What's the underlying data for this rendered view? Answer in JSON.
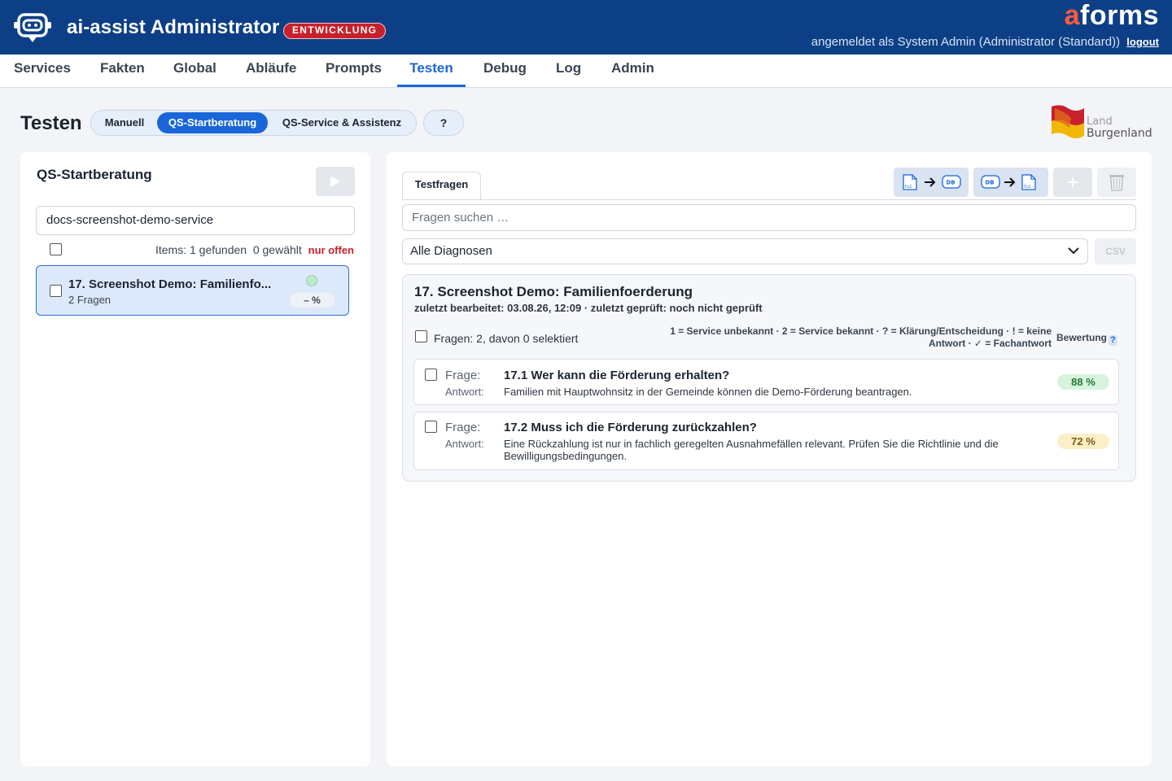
{
  "header": {
    "app_title": "ai-assist Administrator",
    "env_badge": "ENTWICKLUNG",
    "brand_first": "a",
    "brand_rest": "forms",
    "login_text": "angemeldet als System Admin (Administrator (Standard))",
    "logout_label": "logout"
  },
  "nav": {
    "items": [
      "Services",
      "Fakten",
      "Global",
      "Abläufe",
      "Prompts",
      "Testen",
      "Debug",
      "Log",
      "Admin"
    ],
    "active": "Testen"
  },
  "page": {
    "title": "Testen",
    "modes": [
      "Manuell",
      "QS-Startberatung",
      "QS-Service & Assistenz"
    ],
    "active_mode": "QS-Startberatung",
    "help_label": "?",
    "logo_line1": "Land",
    "logo_line2": "Burgenland"
  },
  "left": {
    "title": "QS-Startberatung",
    "service_value": "docs-screenshot-demo-service",
    "items_info": "Items: 1 gefunden  0 gewählt",
    "only_open_label": "nur offen",
    "list": [
      {
        "title": "17. Screenshot Demo: Familienfo...",
        "subtitle": "2 Fragen",
        "pct": "– %"
      }
    ]
  },
  "right": {
    "tab_label": "Testfragen",
    "toolbar_icons": [
      "file-to-db-icon",
      "db-to-file-icon",
      "plus-icon",
      "trash-icon"
    ],
    "search_placeholder": "Fragen suchen …",
    "diagnosis_value": "Alle Diagnosen",
    "csv_label": "CSV",
    "group": {
      "title": "17. Screenshot Demo: Familienfoerderung",
      "meta": "zuletzt bearbeitet: 03.08.26, 12:09 · zuletzt geprüft: noch nicht geprüft",
      "count_text": "Fragen: 2, davon 0 selektiert",
      "legend_line1": "1 = Service unbekannt · 2 = Service bekannt · ? = Klärung/Entscheidung · ! = keine",
      "legend_line2": "Antwort · ✓ = Fachantwort",
      "rating_label": "Bewertung",
      "rating_help": "?",
      "question_label": "Frage:",
      "answer_label": "Antwort:",
      "questions": [
        {
          "question": "17.1 Wer kann die Förderung erhalten?",
          "answer": "Familien mit Hauptwohnsitz in der Gemeinde können die Demo-Förderung beantragen.",
          "score": "88 %"
        },
        {
          "question": "17.2 Muss ich die Förderung zurückzahlen?",
          "answer": "Eine Rückzahlung ist nur in fachlich geregelten Ausnahmefällen relevant. Prüfen Sie die Richtlinie und die Bewilligungsbedingungen.",
          "score": "72 %"
        }
      ]
    }
  },
  "colors": {
    "header_bg": "#0d3f86",
    "accent": "#1a66d9",
    "badge_red": "#c8202c",
    "brand_orange": "#ff5a3c"
  }
}
